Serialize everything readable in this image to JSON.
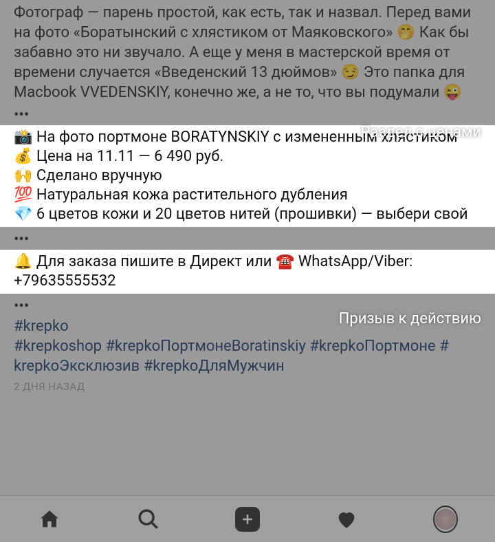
{
  "post": {
    "intro": "Фотограф — парень простой, как есть, так и назвал. Перед вами на фото «Боратынский с хлястиком от Маяковского» 🤭 Как бы забавно это ни звучало. А еще у меня в мастерской время от времени случается «Введенский 13 дюймов» 😏 Это папка для Macbook VVEDENSKIY, конечно же, а не то, что вы подумали 😜",
    "ellipsis": "•••",
    "price_block_label": "Раздел с ценами",
    "price_block": {
      "l1": "📸 На фото портмоне BORATYNSKIY с измененным хлястиком",
      "l2": "💰 Цена на 11.11 — 6 490 руб.",
      "l3": "🙌 Сделано вручную",
      "l4": "💯 Натуральная кожа растительного дубления",
      "l5": "💎 6 цветов кожи и 20 цветов нитей (прошивки) — выбери свой"
    },
    "cta_label": "Призыв к действию",
    "cta": "🔔 Для заказа пишите в Директ или ☎️ WhatsApp/Viber: +79635555532",
    "hashtags": {
      "h1": "#krepko",
      "h2": "#krepkoshop",
      "h3": "#krepkoПортмонеBoratinskiy",
      "h4": "#krepkoПортмоне",
      "h5": "#krepkoЭксклюзив",
      "h6": "#krepkoДляМужчин"
    },
    "timestamp": "2 ДНЯ НАЗАД"
  },
  "nav": {
    "home": "home-icon",
    "search": "search-icon",
    "add": "add-icon",
    "activity": "heart-icon",
    "profile": "profile-avatar"
  }
}
